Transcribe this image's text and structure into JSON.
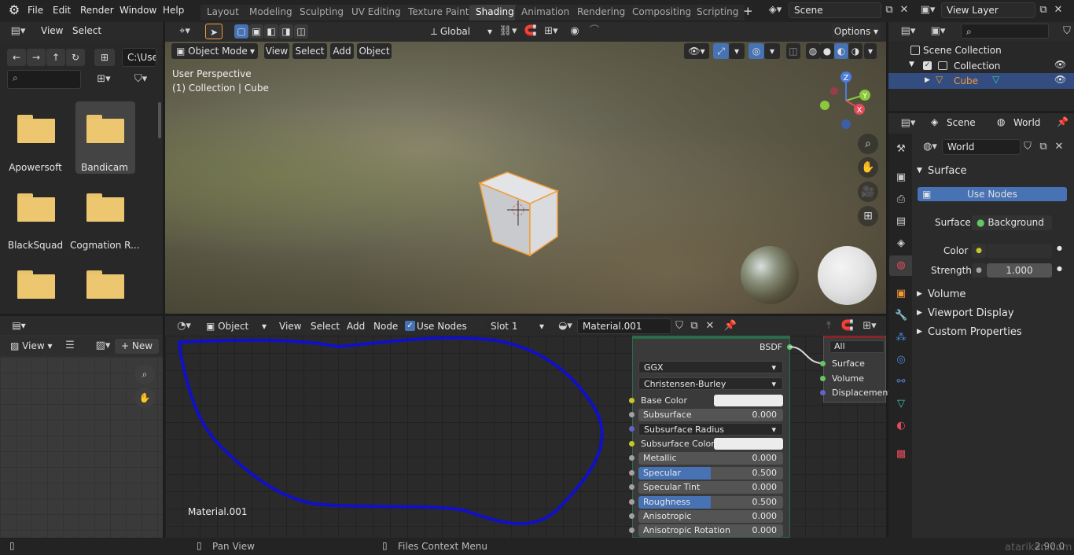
{
  "menu": {
    "logo": "blender-logo",
    "items": [
      "File",
      "Edit",
      "Render",
      "Window",
      "Help"
    ]
  },
  "workspaces": [
    "Layout",
    "Modeling",
    "Sculpting",
    "UV Editing",
    "Texture Paint",
    "Shading",
    "Animation",
    "Rendering",
    "Compositing",
    "Scripting"
  ],
  "active_workspace": "Shading",
  "add_workspace": "+",
  "scene_name": "Scene",
  "view_layer": "View Layer",
  "file_browser": {
    "menu_view": "View",
    "menu_select": "Select",
    "path": "C:\\Use",
    "files": [
      "Apowersoft",
      "Bandicam",
      "BlackSquad",
      "Cogmation R...",
      "",
      ""
    ],
    "selected_file": "Bandicam"
  },
  "viewport": {
    "transform": "Global",
    "options": "Options",
    "mode": "Object Mode",
    "menus": [
      "View",
      "Select",
      "Add",
      "Object"
    ],
    "perspective": "User Perspective",
    "collection_info": "(1) Collection | Cube",
    "gizmo": {
      "z": "Z",
      "y": "Y",
      "x": "X"
    }
  },
  "image_editor": {
    "view": "View",
    "new": "New"
  },
  "node_editor": {
    "object_type": "Object",
    "menus": [
      "View",
      "Select",
      "Add",
      "Node"
    ],
    "use_nodes": "Use Nodes",
    "slot": "Slot 1",
    "material": "Material.001",
    "material_label": "Material.001",
    "bsdf": {
      "output": "BSDF",
      "distribution": "GGX",
      "subsurface_method": "Christensen-Burley",
      "base_color": "Base Color",
      "subsurface": "Subsurface",
      "subsurface_value": "0.000",
      "subsurface_radius": "Subsurface Radius",
      "subsurface_color": "Subsurface Color",
      "metallic": "Metallic",
      "metallic_value": "0.000",
      "specular": "Specular",
      "specular_value": "0.500",
      "specular_tint": "Specular Tint",
      "specular_tint_value": "0.000",
      "roughness": "Roughness",
      "roughness_value": "0.500",
      "anisotropic": "Anisotropic",
      "anisotropic_value": "0.000",
      "anisotropic_rotation": "Anisotropic Rotation",
      "anisotropic_rotation_value": "0.000"
    },
    "output_node": {
      "target": "All",
      "surface": "Surface",
      "volume": "Volume",
      "displacement": "Displacement"
    },
    "annotation_color": "#1010c8"
  },
  "outliner": {
    "root": "Scene Collection",
    "collection": "Collection",
    "object": "Cube"
  },
  "properties": {
    "scene_tab": "Scene",
    "world_tab": "World",
    "world_name": "World",
    "surface_section": "Surface",
    "use_nodes": "Use Nodes",
    "surface_label": "Surface",
    "surface_value": "Background",
    "color_label": "Color",
    "strength_label": "Strength",
    "strength_value": "1.000",
    "volume_section": "Volume",
    "viewport_display_section": "Viewport Display",
    "custom_properties_section": "Custom Properties"
  },
  "status_bar": {
    "pan_view": "Pan View",
    "context_menu": "Files Context Menu",
    "version": "2.90.0"
  },
  "watermark": "atarikan.com",
  "colors": {
    "accent": "#4772b3",
    "selected_orange": "#f39c35",
    "socket_yellow": "#c7c729",
    "socket_gray": "#a1a1a1",
    "socket_green": "#63c763",
    "socket_purple": "#6363c7",
    "shader_header": "#2b6b4a"
  }
}
